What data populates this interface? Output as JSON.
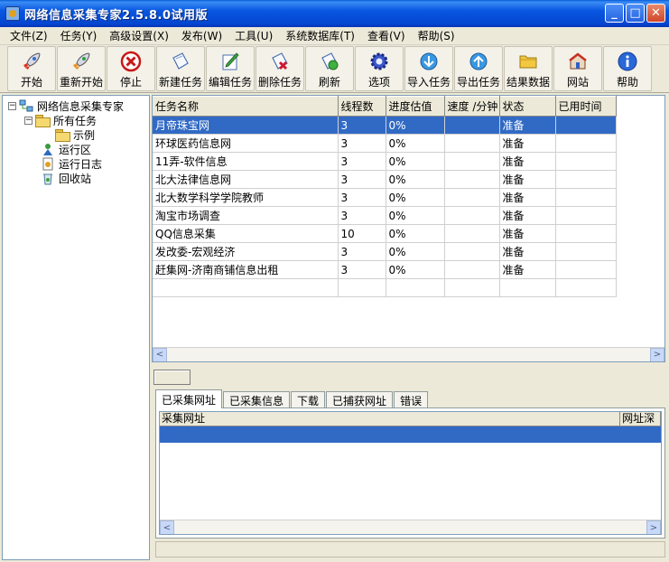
{
  "window": {
    "title": "网络信息采集专家2.5.8.0试用版",
    "min_symbol": "_",
    "max_symbol": "□",
    "close_symbol": "✕"
  },
  "menu": [
    {
      "label": "文件(Z)"
    },
    {
      "label": "任务(Y)"
    },
    {
      "label": "高级设置(X)"
    },
    {
      "label": "发布(W)"
    },
    {
      "label": "工具(U)"
    },
    {
      "label": "系统数据库(T)"
    },
    {
      "label": "查看(V)"
    },
    {
      "label": "帮助(S)"
    }
  ],
  "toolbar": [
    {
      "label": "开始",
      "icon": "rocket-icon",
      "color": "#d03020"
    },
    {
      "label": "重新开始",
      "icon": "rocket-restart-icon",
      "color": "#d08020"
    },
    {
      "label": "停止",
      "icon": "stop-icon",
      "color": "#d82020"
    },
    {
      "label": "新建任务",
      "icon": "new-task-icon",
      "color": "#4a90d0"
    },
    {
      "label": "编辑任务",
      "icon": "edit-task-icon",
      "color": "#3a9a40"
    },
    {
      "label": "删除任务",
      "icon": "delete-task-icon",
      "color": "#d02040"
    },
    {
      "label": "刷新",
      "icon": "refresh-icon",
      "color": "#30a030"
    },
    {
      "label": "选项",
      "icon": "gear-icon",
      "color": "#3050c0"
    },
    {
      "label": "导入任务",
      "icon": "import-icon",
      "color": "#2080d0"
    },
    {
      "label": "导出任务",
      "icon": "export-icon",
      "color": "#2080d0"
    },
    {
      "label": "结果数据",
      "icon": "folder-icon",
      "color": "#e0b030"
    },
    {
      "label": "网站",
      "icon": "website-icon",
      "color": "#c04030"
    },
    {
      "label": "帮助",
      "icon": "info-icon",
      "color": "#2060d0"
    }
  ],
  "tree": {
    "root": "网络信息采集专家",
    "all_tasks": "所有任务",
    "example": "示例",
    "running": "运行区",
    "log": "运行日志",
    "recycle": "回收站",
    "collapse_symbol": "−"
  },
  "tasks": {
    "columns": [
      "任务名称",
      "线程数",
      "进度估值",
      "速度 /分钟",
      "状态",
      "已用时间"
    ],
    "rows": [
      [
        "月帝珠宝网",
        "3",
        "0%",
        "",
        "准备",
        ""
      ],
      [
        "环球医药信息网",
        "3",
        "0%",
        "",
        "准备",
        ""
      ],
      [
        "11弄-软件信息",
        "3",
        "0%",
        "",
        "准备",
        ""
      ],
      [
        "北大法律信息网",
        "3",
        "0%",
        "",
        "准备",
        ""
      ],
      [
        "北大数学科学学院教师",
        "3",
        "0%",
        "",
        "准备",
        ""
      ],
      [
        "淘宝市场调查",
        "3",
        "0%",
        "",
        "准备",
        ""
      ],
      [
        "QQ信息采集",
        "10",
        "0%",
        "",
        "准备",
        ""
      ],
      [
        "发改委-宏观经济",
        "3",
        "0%",
        "",
        "准备",
        ""
      ],
      [
        "赶集网-济南商铺信息出租",
        "3",
        "0%",
        "",
        "准备",
        ""
      ]
    ],
    "selected_row": 0
  },
  "bottom_tabs": [
    {
      "label": "已采集网址",
      "active": true
    },
    {
      "label": "已采集信息",
      "active": false
    },
    {
      "label": "下载",
      "active": false
    },
    {
      "label": "已捕获网址",
      "active": false
    },
    {
      "label": "错误",
      "active": false
    }
  ],
  "url_table": {
    "columns": [
      "采集网址",
      "网址深"
    ]
  },
  "scroll": {
    "left": "<",
    "right": ">"
  }
}
